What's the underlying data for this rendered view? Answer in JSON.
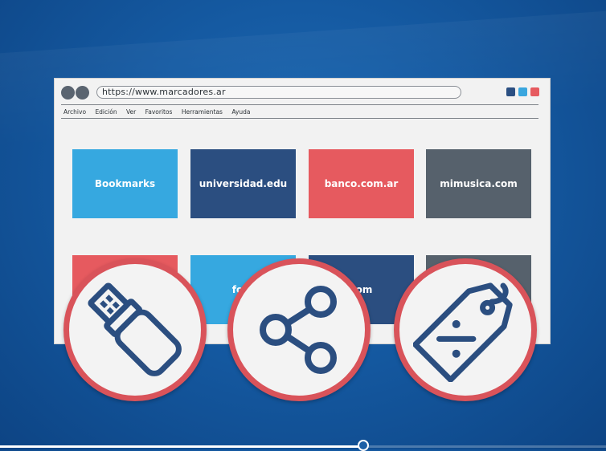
{
  "browser": {
    "url": "https://www.marcadores.ar",
    "menu": [
      "Archivo",
      "Edición",
      "Ver",
      "Favoritos",
      "Herramientas",
      "Ayuda"
    ],
    "tiles_row1": [
      "Bookmarks",
      "universidad.edu",
      "banco.com.ar",
      "mimusica.com"
    ],
    "tiles_row2": [
      "",
      "foto",
      "com",
      ""
    ]
  },
  "icons": [
    "usb-drive-icon",
    "share-icon",
    "price-tag-icon"
  ],
  "colors": {
    "cyan": "#36a8e0",
    "navy": "#2b4e80",
    "red": "#e65a5f",
    "slate": "#56616c",
    "icon_stroke": "#2b4e80",
    "circle_border": "#d9535a"
  },
  "video": {
    "progress": 0.6
  }
}
